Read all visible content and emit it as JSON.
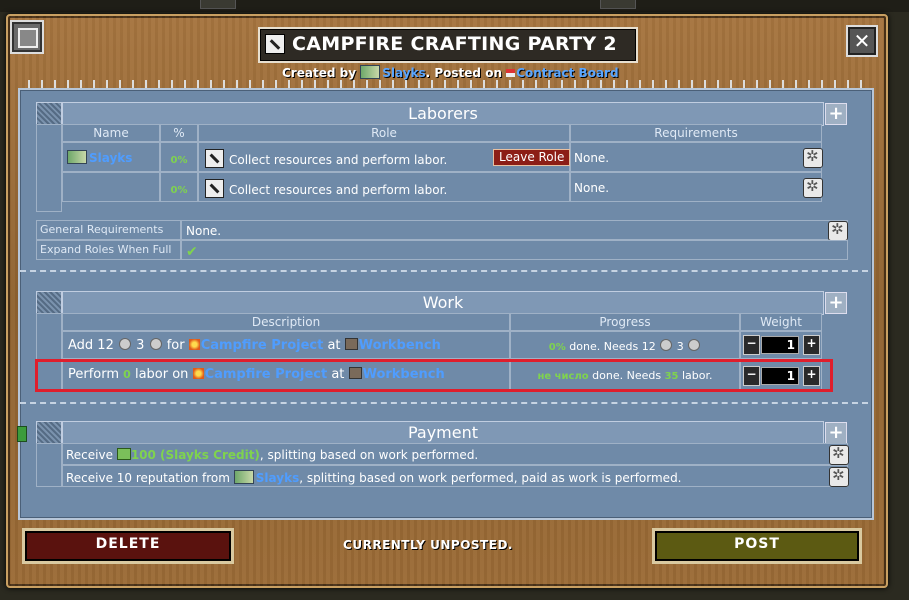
{
  "window": {
    "title": "CAMPFIRE CRAFTING PARTY 2",
    "created_by_prefix": "Created by",
    "creator": "Slayks",
    "posted_on_prefix": ". Posted on",
    "board": "Contract Board",
    "close_symbol": "✕"
  },
  "laborers": {
    "title": "Laborers",
    "add_symbol": "+",
    "columns": {
      "name": "Name",
      "pct": "%",
      "role": "Role",
      "requirements": "Requirements"
    },
    "rows": [
      {
        "name": "Slayks",
        "pct": "0%",
        "role": "Collect resources and perform labor.",
        "action": "Leave Role",
        "requirements": "None."
      },
      {
        "name": "",
        "pct": "0%",
        "role": "Collect resources and perform labor.",
        "requirements": "None."
      }
    ],
    "general_requirements_label": "General Requirements",
    "general_requirements_value": "None.",
    "expand_roles_label": "Expand Roles When Full",
    "expand_roles_value": "✔"
  },
  "work": {
    "title": "Work",
    "add_symbol": "+",
    "columns": {
      "description": "Description",
      "progress": "Progress",
      "weight": "Weight"
    },
    "rows": [
      {
        "desc_prefix": "Add 12",
        "desc_qty2": "3",
        "desc_for": "for",
        "project": "Campfire Project",
        "at": "at",
        "station": "Workbench",
        "progress_pct": "0%",
        "progress_text": "done. Needs 12",
        "progress_qty2": "3",
        "weight": "1"
      },
      {
        "desc_prefix": "Perform",
        "desc_amount": "0",
        "desc_mid": "labor on",
        "project": "Campfire Project",
        "at": "at",
        "station": "Workbench",
        "progress_pct": "не число",
        "progress_text": "done. Needs",
        "progress_amount": "35",
        "progress_suffix": "labor.",
        "weight": "1"
      }
    ],
    "minus_symbol": "−",
    "plus_symbol": "+"
  },
  "payment": {
    "title": "Payment",
    "add_symbol": "+",
    "rows": [
      {
        "prefix": "Receive",
        "amount": "100 (Slayks Credit)",
        "suffix": ", splitting based on work performed."
      },
      {
        "prefix": "Receive 10 reputation from",
        "who": "Slayks",
        "suffix": ", splitting based on work performed, paid as work is performed."
      }
    ]
  },
  "footer": {
    "delete_label": "DELETE",
    "status": "CURRENTLY UNPOSTED.",
    "post_label": "POST"
  },
  "colors": {
    "link": "#4f9dff",
    "percent": "#7fd34e",
    "highlight": "#e01e2c"
  }
}
